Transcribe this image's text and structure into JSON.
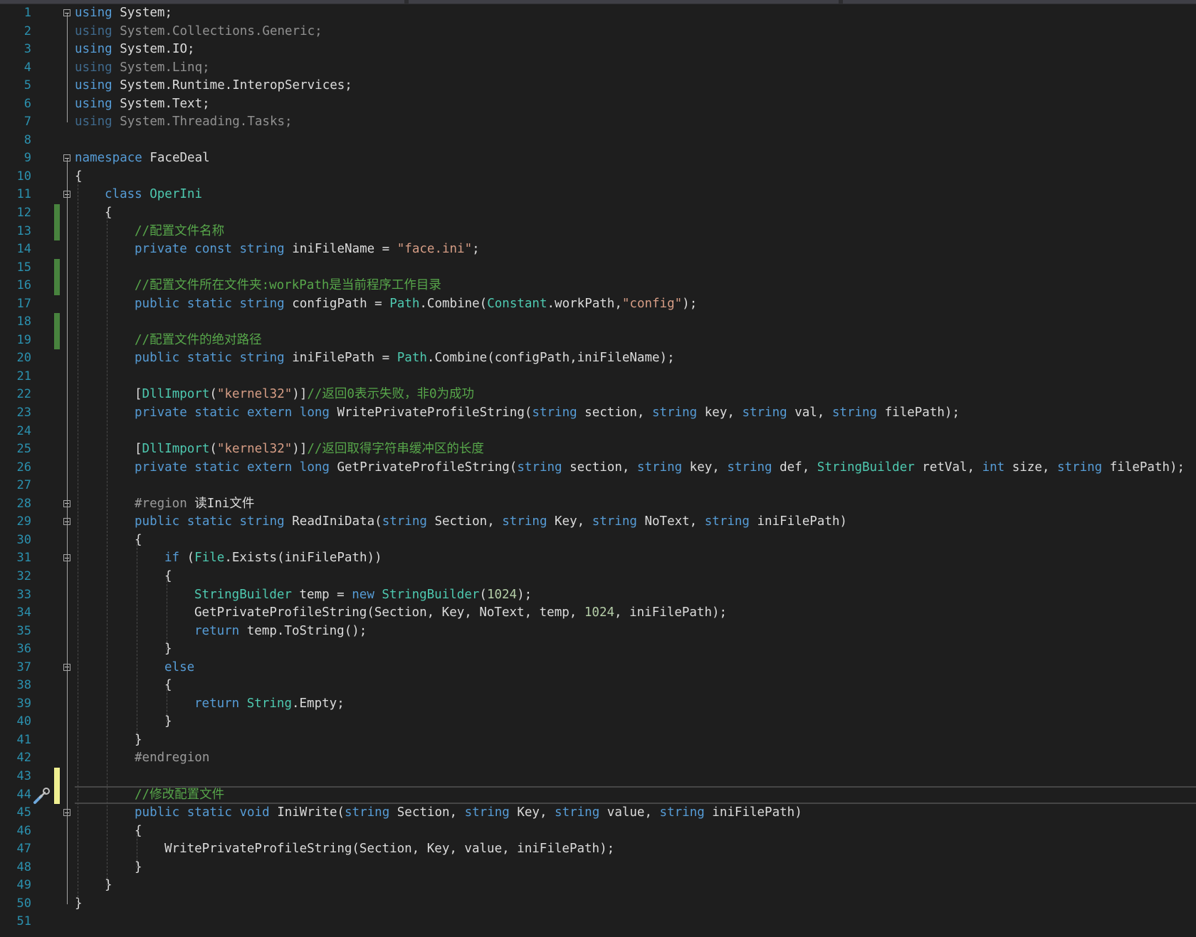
{
  "editor": {
    "lines": [
      {
        "n": "1",
        "fold": true,
        "indent": 0,
        "tokens": [
          [
            "kw",
            "using"
          ],
          [
            "id",
            " System;"
          ]
        ]
      },
      {
        "n": "2",
        "indent": 0,
        "tokens": [
          [
            "kw",
            "using"
          ],
          [
            "id",
            " System.Collections.Generic;"
          ]
        ],
        "dim": true
      },
      {
        "n": "3",
        "indent": 0,
        "tokens": [
          [
            "kw",
            "using"
          ],
          [
            "id",
            " System.IO;"
          ]
        ]
      },
      {
        "n": "4",
        "indent": 0,
        "tokens": [
          [
            "kw",
            "using"
          ],
          [
            "id",
            " System.Linq;"
          ]
        ],
        "dim": true
      },
      {
        "n": "5",
        "indent": 0,
        "tokens": [
          [
            "kw",
            "using"
          ],
          [
            "id",
            " System.Runtime.InteropServices;"
          ]
        ]
      },
      {
        "n": "6",
        "indent": 0,
        "tokens": [
          [
            "kw",
            "using"
          ],
          [
            "id",
            " System.Text;"
          ]
        ]
      },
      {
        "n": "7",
        "indent": 0,
        "tokens": [
          [
            "kw",
            "using"
          ],
          [
            "id",
            " System.Threading.Tasks;"
          ]
        ],
        "dim": true
      },
      {
        "n": "8",
        "indent": 0,
        "tokens": []
      },
      {
        "n": "9",
        "fold": true,
        "indent": 0,
        "tokens": [
          [
            "kw",
            "namespace"
          ],
          [
            "id",
            " FaceDeal"
          ]
        ]
      },
      {
        "n": "10",
        "indent": 0,
        "tokens": [
          [
            "id",
            "{"
          ]
        ]
      },
      {
        "n": "11",
        "fold": true,
        "indent": 1,
        "tokens": [
          [
            "kw",
            "class"
          ],
          [
            "id",
            " "
          ],
          [
            "ty",
            "OperIni"
          ]
        ]
      },
      {
        "n": "12",
        "indent": 1,
        "change": "saved",
        "tokens": [
          [
            "id",
            "{"
          ]
        ]
      },
      {
        "n": "13",
        "indent": 2,
        "change": "saved",
        "tokens": [
          [
            "cm",
            "//配置文件名称"
          ]
        ]
      },
      {
        "n": "14",
        "indent": 2,
        "tokens": [
          [
            "kw",
            "private const string"
          ],
          [
            "id",
            " iniFileName = "
          ],
          [
            "st",
            "\"face.ini\""
          ],
          [
            "id",
            ";"
          ]
        ]
      },
      {
        "n": "15",
        "indent": 2,
        "change": "saved",
        "tokens": []
      },
      {
        "n": "16",
        "indent": 2,
        "change": "saved",
        "tokens": [
          [
            "cm",
            "//配置文件所在文件夹:workPath是当前程序工作目录"
          ]
        ]
      },
      {
        "n": "17",
        "indent": 2,
        "tokens": [
          [
            "kw",
            "public static string"
          ],
          [
            "id",
            " configPath = "
          ],
          [
            "ty",
            "Path"
          ],
          [
            "id",
            ".Combine("
          ],
          [
            "ty",
            "Constant"
          ],
          [
            "id",
            ".workPath,"
          ],
          [
            "st",
            "\"config\""
          ],
          [
            "id",
            ");"
          ]
        ]
      },
      {
        "n": "18",
        "indent": 2,
        "change": "saved",
        "tokens": []
      },
      {
        "n": "19",
        "indent": 2,
        "change": "saved",
        "tokens": [
          [
            "cm",
            "//配置文件的绝对路径"
          ]
        ]
      },
      {
        "n": "20",
        "indent": 2,
        "tokens": [
          [
            "kw",
            "public static string"
          ],
          [
            "id",
            " iniFilePath = "
          ],
          [
            "ty",
            "Path"
          ],
          [
            "id",
            ".Combine(configPath,iniFileName);"
          ]
        ]
      },
      {
        "n": "21",
        "indent": 2,
        "tokens": []
      },
      {
        "n": "22",
        "indent": 2,
        "tokens": [
          [
            "id",
            "["
          ],
          [
            "ty",
            "DllImport"
          ],
          [
            "id",
            "("
          ],
          [
            "st",
            "\"kernel32\""
          ],
          [
            "id",
            ")]"
          ],
          [
            "cm",
            "//返回0表示失败，非0为成功"
          ]
        ]
      },
      {
        "n": "23",
        "indent": 2,
        "tokens": [
          [
            "kw",
            "private static extern long"
          ],
          [
            "id",
            " WritePrivateProfileString("
          ],
          [
            "kw",
            "string"
          ],
          [
            "id",
            " section, "
          ],
          [
            "kw",
            "string"
          ],
          [
            "id",
            " key, "
          ],
          [
            "kw",
            "string"
          ],
          [
            "id",
            " val, "
          ],
          [
            "kw",
            "string"
          ],
          [
            "id",
            " filePath);"
          ]
        ]
      },
      {
        "n": "24",
        "indent": 2,
        "tokens": []
      },
      {
        "n": "25",
        "indent": 2,
        "tokens": [
          [
            "id",
            "["
          ],
          [
            "ty",
            "DllImport"
          ],
          [
            "id",
            "("
          ],
          [
            "st",
            "\"kernel32\""
          ],
          [
            "id",
            ")]"
          ],
          [
            "cm",
            "//返回取得字符串缓冲区的长度"
          ]
        ]
      },
      {
        "n": "26",
        "indent": 2,
        "tokens": [
          [
            "kw",
            "private static extern long"
          ],
          [
            "id",
            " GetPrivateProfileString("
          ],
          [
            "kw",
            "string"
          ],
          [
            "id",
            " section, "
          ],
          [
            "kw",
            "string"
          ],
          [
            "id",
            " key, "
          ],
          [
            "kw",
            "string"
          ],
          [
            "id",
            " def, "
          ],
          [
            "ty",
            "StringBuilder"
          ],
          [
            "id",
            " retVal, "
          ],
          [
            "kw",
            "int"
          ],
          [
            "id",
            " size, "
          ],
          [
            "kw",
            "string"
          ],
          [
            "id",
            " filePath);"
          ]
        ]
      },
      {
        "n": "27",
        "indent": 2,
        "tokens": []
      },
      {
        "n": "28",
        "fold": true,
        "indent": 2,
        "tokens": [
          [
            "pp",
            "#region"
          ],
          [
            "id",
            " 读Ini文件"
          ]
        ]
      },
      {
        "n": "29",
        "fold": true,
        "indent": 2,
        "tokens": [
          [
            "kw",
            "public static string"
          ],
          [
            "id",
            " ReadIniData("
          ],
          [
            "kw",
            "string"
          ],
          [
            "id",
            " Section, "
          ],
          [
            "kw",
            "string"
          ],
          [
            "id",
            " Key, "
          ],
          [
            "kw",
            "string"
          ],
          [
            "id",
            " NoText, "
          ],
          [
            "kw",
            "string"
          ],
          [
            "id",
            " iniFilePath)"
          ]
        ]
      },
      {
        "n": "30",
        "indent": 2,
        "tokens": [
          [
            "id",
            "{"
          ]
        ]
      },
      {
        "n": "31",
        "fold": true,
        "indent": 3,
        "tokens": [
          [
            "kw",
            "if"
          ],
          [
            "id",
            " ("
          ],
          [
            "ty",
            "File"
          ],
          [
            "id",
            ".Exists(iniFilePath))"
          ]
        ]
      },
      {
        "n": "32",
        "indent": 3,
        "tokens": [
          [
            "id",
            "{"
          ]
        ]
      },
      {
        "n": "33",
        "indent": 4,
        "tokens": [
          [
            "ty",
            "StringBuilder"
          ],
          [
            "id",
            " temp = "
          ],
          [
            "kw",
            "new"
          ],
          [
            "id",
            " "
          ],
          [
            "ty",
            "StringBuilder"
          ],
          [
            "id",
            "("
          ],
          [
            "nu",
            "1024"
          ],
          [
            "id",
            ");"
          ]
        ]
      },
      {
        "n": "34",
        "indent": 4,
        "tokens": [
          [
            "id",
            "GetPrivateProfileString(Section, Key, NoText, temp, "
          ],
          [
            "nu",
            "1024"
          ],
          [
            "id",
            ", iniFilePath);"
          ]
        ]
      },
      {
        "n": "35",
        "indent": 4,
        "tokens": [
          [
            "kw",
            "return"
          ],
          [
            "id",
            " temp.ToString();"
          ]
        ]
      },
      {
        "n": "36",
        "indent": 3,
        "tokens": [
          [
            "id",
            "}"
          ]
        ]
      },
      {
        "n": "37",
        "fold": true,
        "indent": 3,
        "tokens": [
          [
            "kw",
            "else"
          ]
        ]
      },
      {
        "n": "38",
        "indent": 3,
        "tokens": [
          [
            "id",
            "{"
          ]
        ]
      },
      {
        "n": "39",
        "indent": 4,
        "tokens": [
          [
            "kw",
            "return"
          ],
          [
            "id",
            " "
          ],
          [
            "ty",
            "String"
          ],
          [
            "id",
            ".Empty;"
          ]
        ]
      },
      {
        "n": "40",
        "indent": 3,
        "tokens": [
          [
            "id",
            "}"
          ]
        ]
      },
      {
        "n": "41",
        "indent": 2,
        "tokens": [
          [
            "id",
            "}"
          ]
        ]
      },
      {
        "n": "42",
        "indent": 2,
        "tokens": [
          [
            "pp",
            "#endregion"
          ]
        ]
      },
      {
        "n": "43",
        "indent": 2,
        "change": "unsaved",
        "tokens": []
      },
      {
        "n": "44",
        "indent": 2,
        "change": "unsaved",
        "current": true,
        "tokens": [
          [
            "cm",
            "//修改配置文件"
          ]
        ]
      },
      {
        "n": "45",
        "fold": true,
        "indent": 2,
        "tokens": [
          [
            "kw",
            "public static void"
          ],
          [
            "id",
            " IniWrite("
          ],
          [
            "kw",
            "string"
          ],
          [
            "id",
            " Section, "
          ],
          [
            "kw",
            "string"
          ],
          [
            "id",
            " Key, "
          ],
          [
            "kw",
            "string"
          ],
          [
            "id",
            " value, "
          ],
          [
            "kw",
            "string"
          ],
          [
            "id",
            " iniFilePath)"
          ]
        ]
      },
      {
        "n": "46",
        "indent": 2,
        "tokens": [
          [
            "id",
            "{"
          ]
        ]
      },
      {
        "n": "47",
        "indent": 3,
        "tokens": [
          [
            "id",
            "WritePrivateProfileString(Section, Key, value, iniFilePath);"
          ]
        ]
      },
      {
        "n": "48",
        "indent": 2,
        "tokens": [
          [
            "id",
            "}"
          ]
        ]
      },
      {
        "n": "49",
        "indent": 1,
        "tokens": [
          [
            "id",
            "}"
          ]
        ]
      },
      {
        "n": "50",
        "indent": 0,
        "tokens": [
          [
            "id",
            "}"
          ]
        ]
      },
      {
        "n": "51",
        "indent": 0,
        "tokens": []
      }
    ]
  },
  "icons": {
    "quick_actions": "screwdriver-icon",
    "fold": "collapse-minus-icon"
  },
  "colors": {
    "background": "#1e1e1e",
    "keyword": "#569cd6",
    "type": "#4ec9b0",
    "string": "#d69d85",
    "comment": "#57a64a",
    "number": "#b5cea8",
    "line_number": "#2b91af",
    "saved_change": "#57a64a",
    "unsaved_change": "#efef91"
  }
}
